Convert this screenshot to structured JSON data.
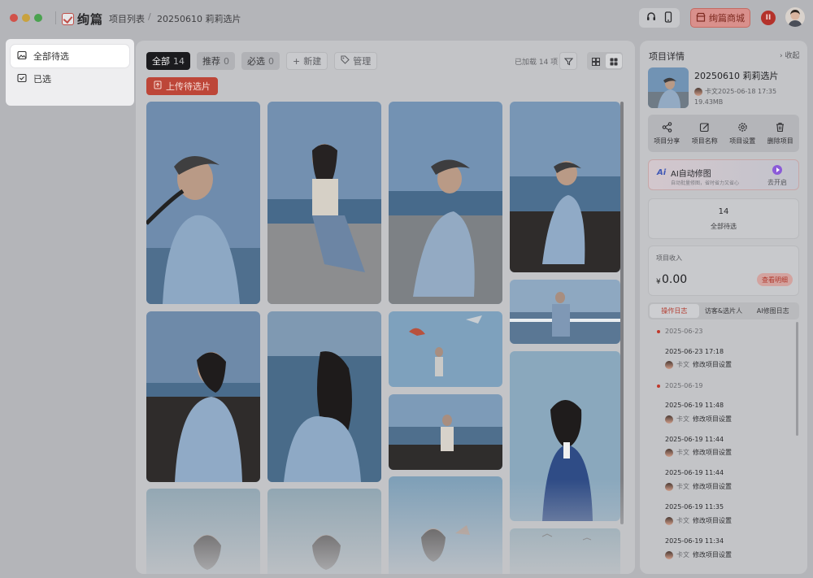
{
  "app": {
    "logo_text": "绚篇",
    "traffic_lights": [
      "#d1524a",
      "#c9a23e",
      "#4aa24f"
    ]
  },
  "breadcrumb": {
    "root": "项目列表",
    "current": "20250610 莉莉选片"
  },
  "titlebar": {
    "shop_label": "绚篇商城",
    "badge_text": "II"
  },
  "sidebar": {
    "items": [
      {
        "label": "全部待选",
        "icon": "image-icon",
        "active": true
      },
      {
        "label": "已选",
        "icon": "image-check-icon",
        "active": false
      }
    ]
  },
  "toolbar": {
    "tabs": [
      {
        "label": "全部",
        "count": "14",
        "active": true
      },
      {
        "label": "推荐",
        "count": "0"
      },
      {
        "label": "必选",
        "count": "0"
      }
    ],
    "new_label": "新建",
    "manage_label": "管理",
    "loaded_text": "已加载 14 项",
    "upload_label": "上传待选片"
  },
  "project": {
    "panel_title": "项目详情",
    "collapse_label": "收起",
    "name": "20250610 莉莉选片",
    "author_date": "卡文2025-06-18 17:35",
    "size": "19.43MB",
    "actions": [
      {
        "label": "项目分享",
        "icon": "share-icon"
      },
      {
        "label": "项目名称",
        "icon": "edit-icon"
      },
      {
        "label": "项目设置",
        "icon": "gear-icon"
      },
      {
        "label": "删除项目",
        "icon": "trash-icon"
      }
    ],
    "ai": {
      "logo": "Ai",
      "title": "AI自动修图",
      "subtitle": "自动批量修图，省时省力又省心",
      "go_label": "去开启"
    },
    "pending_count": "14",
    "pending_label": "全部待选",
    "income_label": "项目收入",
    "income_currency": "¥",
    "income_value": "0.00",
    "income_detail": "查看明细"
  },
  "log": {
    "tabs": [
      {
        "label": "操作日志",
        "active": true
      },
      {
        "label": "访客&选片人"
      },
      {
        "label": "AI修图日志"
      }
    ],
    "entries": [
      {
        "date": "2025-06-23",
        "items": [
          {
            "time": "2025-06-23 17:18",
            "user": "卡文",
            "action": "修改项目设置"
          }
        ]
      },
      {
        "date": "2025-06-19",
        "items": [
          {
            "time": "2025-06-19 11:48",
            "user": "卡文",
            "action": "修改项目设置"
          },
          {
            "time": "2025-06-19 11:44",
            "user": "卡文",
            "action": "修改项目设置"
          },
          {
            "time": "2025-06-19 11:44",
            "user": "卡文",
            "action": "修改项目设置"
          },
          {
            "time": "2025-06-19 11:35",
            "user": "卡文",
            "action": "修改项目设置"
          },
          {
            "time": "2025-06-19 11:34",
            "user": "卡文",
            "action": "修改项目设置"
          }
        ]
      }
    ]
  },
  "photos": [
    {
      "desc": "girl-cap-seaside"
    },
    {
      "desc": "girl-cap-sitting-rock"
    },
    {
      "desc": "girl-cap-beach-sit"
    },
    {
      "desc": "girl-cap-rocks"
    },
    {
      "desc": "girl-rocks-shirt"
    },
    {
      "desc": "girl-back-sea"
    },
    {
      "desc": "girl-kites-sky"
    },
    {
      "desc": "girl-rocks-sitting"
    },
    {
      "desc": "girl-headphones-wave"
    },
    {
      "desc": "girl-headphones-profile"
    },
    {
      "desc": "girl-headphones-sea"
    },
    {
      "desc": "girl-railing"
    },
    {
      "desc": "girl-headphones-sailor"
    },
    {
      "desc": "sea-birds"
    }
  ]
}
